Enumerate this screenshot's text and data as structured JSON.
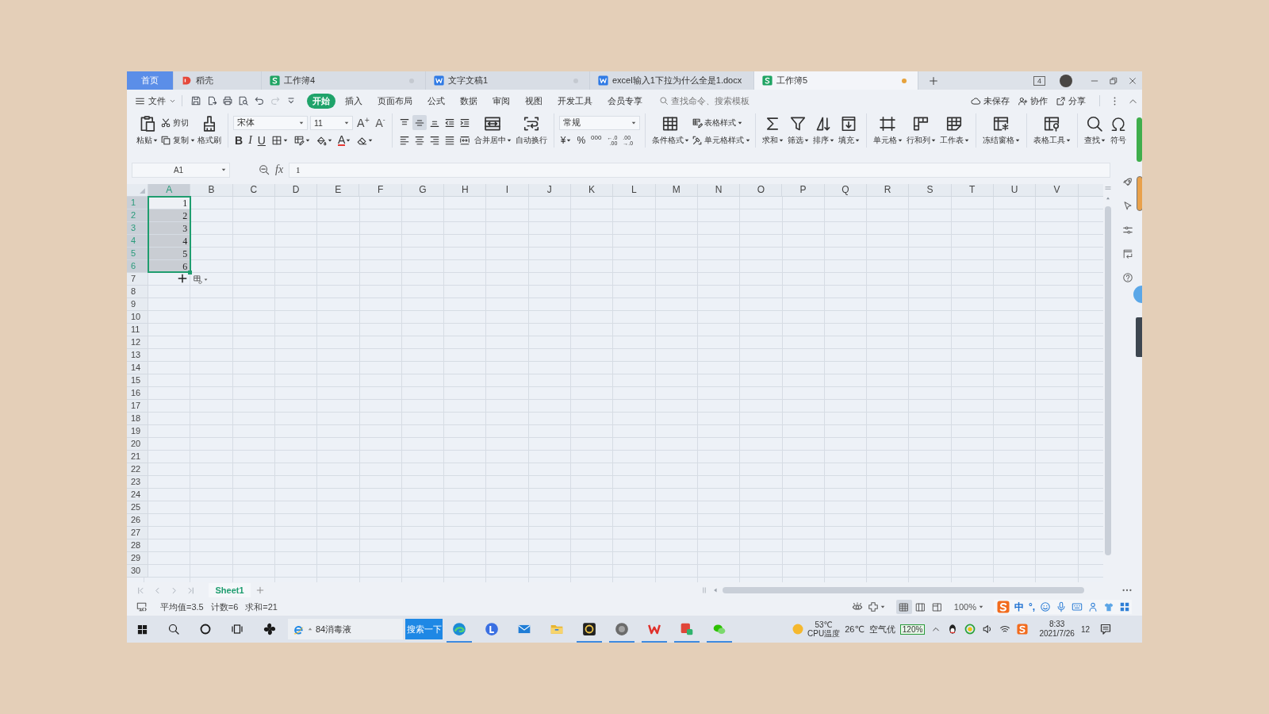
{
  "tabs": [
    {
      "label": "首页",
      "kind": "home",
      "selected": false
    },
    {
      "label": "稻壳",
      "kind": "docer",
      "selected": false
    },
    {
      "label": "工作簿4",
      "kind": "sheet",
      "selected": false,
      "color": "#c4c9d0"
    },
    {
      "label": "文字文稿1",
      "kind": "writer",
      "selected": false,
      "color": "#c4c9d0"
    },
    {
      "label": "excel输入1下拉为什么全是1.docx",
      "kind": "writer",
      "selected": false
    },
    {
      "label": "工作簿5",
      "kind": "sheet",
      "selected": true,
      "color": "#e6a23c"
    }
  ],
  "window_badge": "4",
  "menu": {
    "file": "文件",
    "quick_access": [
      {
        "kind": "save",
        "disabled": false
      },
      {
        "kind": "export",
        "disabled": false
      },
      {
        "kind": "print",
        "disabled": false
      },
      {
        "kind": "print-preview",
        "disabled": false
      },
      {
        "kind": "undo",
        "disabled": false
      },
      {
        "kind": "redo",
        "disabled": true
      },
      {
        "kind": "customize",
        "disabled": false
      }
    ],
    "tabs": [
      {
        "label": "开始",
        "selected": true
      },
      {
        "label": "插入",
        "selected": false
      },
      {
        "label": "页面布局",
        "selected": false
      },
      {
        "label": "公式",
        "selected": false
      },
      {
        "label": "数据",
        "selected": false
      },
      {
        "label": "审阅",
        "selected": false
      },
      {
        "label": "视图",
        "selected": false
      },
      {
        "label": "开发工具",
        "selected": false
      },
      {
        "label": "会员专享",
        "selected": false
      }
    ],
    "search": {
      "placeholder": "查找命令、搜索模板"
    },
    "actions": [
      {
        "kind": "save-status",
        "label": "未保存"
      },
      {
        "kind": "collaborate",
        "label": "协作"
      },
      {
        "kind": "share",
        "label": "分享"
      }
    ]
  },
  "ribbon": [
    {
      "kind": "buttons",
      "columns": [
        [
          {
            "kind": "paste",
            "label": "粘贴",
            "dropdown": true
          }
        ],
        [
          {
            "kind": "cut",
            "label": "剪切",
            "dropdown": false
          },
          {
            "kind": "copy",
            "label": "复制",
            "dropdown": true
          }
        ],
        [
          {
            "kind": "format-painter",
            "label": "格式刷",
            "dropdown": false
          }
        ]
      ]
    },
    {
      "kind": "font",
      "name": "宋体",
      "size": "11",
      "resize": [
        {
          "kind": "grow-font",
          "text": "A$^{+}$"
        },
        {
          "kind": "shrink-font",
          "text": "A$^{-}$"
        }
      ],
      "tools": [
        {
          "kind": "bold",
          "text": "B",
          "dropdown": false
        },
        {
          "kind": "italic",
          "text": "I",
          "dropdown": false
        },
        {
          "kind": "underline",
          "text": "U",
          "dropdown": false
        },
        {
          "kind": "border",
          "dropdown": true
        },
        {
          "kind": "fill-style",
          "dropdown": true
        },
        {
          "kind": "fill-color",
          "dropdown": true
        },
        {
          "kind": "font-color",
          "text": "A",
          "dropdown": true
        },
        {
          "kind": "clear",
          "dropdown": true
        }
      ]
    },
    {
      "kind": "alignment",
      "rows": [
        [
          {
            "kind": "align-top",
            "selected": false
          },
          {
            "kind": "align-middle",
            "selected": true
          },
          {
            "kind": "align-bottom",
            "selected": false
          },
          {
            "kind": "indent-decrease",
            "selected": false
          },
          {
            "kind": "indent-increase",
            "selected": false
          }
        ],
        [
          {
            "kind": "align-left",
            "selected": false
          },
          {
            "kind": "align-center",
            "selected": false
          },
          {
            "kind": "align-right",
            "selected": false
          },
          {
            "kind": "justify",
            "selected": false
          },
          {
            "kind": "distribute",
            "selected": false
          }
        ]
      ],
      "columns": [
        [
          {
            "kind": "merge-center",
            "label": "合并居中",
            "dropdown": true
          }
        ],
        [
          {
            "kind": "wrap-text",
            "label": "自动换行",
            "dropdown": false
          }
        ]
      ]
    },
    {
      "kind": "number",
      "format": "常规",
      "tools": [
        {
          "kind": "currency",
          "text": "¥",
          "dropdown": true
        },
        {
          "kind": "percent",
          "text": "%",
          "dropdown": false
        },
        {
          "kind": "thousands",
          "text": "000",
          "dropdown": false
        },
        {
          "kind": "decimal-increase",
          "lines": [
            "←.0",
            ".00"
          ],
          "dropdown": false
        },
        {
          "kind": "decimal-decrease",
          "lines": [
            ".00",
            "→.0"
          ],
          "dropdown": false
        }
      ]
    },
    {
      "kind": "buttons",
      "columns": [
        [
          {
            "kind": "conditional-format",
            "label": "条件格式",
            "dropdown": true
          }
        ],
        [
          {
            "kind": "table-style",
            "label": "表格样式",
            "dropdown": true
          },
          {
            "kind": "cell-style",
            "label": "单元格样式",
            "dropdown": true
          }
        ]
      ]
    },
    {
      "kind": "buttons",
      "columns": [
        [
          {
            "kind": "sum",
            "label": "求和",
            "dropdown": true
          }
        ],
        [
          {
            "kind": "filter",
            "label": "筛选",
            "dropdown": true
          }
        ],
        [
          {
            "kind": "sort",
            "label": "排序",
            "dropdown": true
          }
        ],
        [
          {
            "kind": "fill",
            "label": "填充",
            "dropdown": true
          }
        ]
      ]
    },
    {
      "kind": "buttons",
      "columns": [
        [
          {
            "kind": "cells",
            "label": "单元格",
            "dropdown": true
          }
        ],
        [
          {
            "kind": "rows-columns",
            "label": "行和列",
            "dropdown": true
          }
        ],
        [
          {
            "kind": "worksheet",
            "label": "工作表",
            "dropdown": true
          }
        ]
      ]
    },
    {
      "kind": "buttons",
      "columns": [
        [
          {
            "kind": "freeze-panes",
            "label": "冻结窗格",
            "dropdown": true
          }
        ]
      ]
    },
    {
      "kind": "buttons",
      "columns": [
        [
          {
            "kind": "table-tools",
            "label": "表格工具",
            "dropdown": true
          }
        ]
      ]
    },
    {
      "kind": "buttons",
      "columns": [
        [
          {
            "kind": "find",
            "label": "查找",
            "dropdown": true
          }
        ],
        [
          {
            "kind": "symbol",
            "label": "符号",
            "dropdown": false
          }
        ]
      ]
    }
  ],
  "formula_bar": {
    "name_box": "A1",
    "function_label": "fx",
    "value": "1"
  },
  "sheet": {
    "columns": [
      {
        "label": "A",
        "selected": true
      },
      {
        "label": "B",
        "selected": false
      },
      {
        "label": "C",
        "selected": false
      },
      {
        "label": "D",
        "selected": false
      },
      {
        "label": "E",
        "selected": false
      },
      {
        "label": "F",
        "selected": false
      },
      {
        "label": "G",
        "selected": false
      },
      {
        "label": "H",
        "selected": false
      },
      {
        "label": "I",
        "selected": false
      },
      {
        "label": "J",
        "selected": false
      },
      {
        "label": "K",
        "selected": false
      },
      {
        "label": "L",
        "selected": false
      },
      {
        "label": "M",
        "selected": false
      },
      {
        "label": "N",
        "selected": false
      },
      {
        "label": "O",
        "selected": false
      },
      {
        "label": "P",
        "selected": false
      },
      {
        "label": "Q",
        "selected": false
      },
      {
        "label": "R",
        "selected": false
      },
      {
        "label": "S",
        "selected": false
      },
      {
        "label": "T",
        "selected": false
      },
      {
        "label": "U",
        "selected": false
      },
      {
        "label": "V",
        "selected": false
      }
    ],
    "rows": [
      {
        "number": "1",
        "selected": true,
        "cells": [
          {
            "value": "1",
            "selected": true,
            "active": true
          }
        ]
      },
      {
        "number": "2",
        "selected": true,
        "cells": [
          {
            "value": "2",
            "selected": true,
            "active": false
          }
        ]
      },
      {
        "number": "3",
        "selected": true,
        "cells": [
          {
            "value": "3",
            "selected": true,
            "active": false
          }
        ]
      },
      {
        "number": "4",
        "selected": true,
        "cells": [
          {
            "value": "4",
            "selected": true,
            "active": false
          }
        ]
      },
      {
        "number": "5",
        "selected": true,
        "cells": [
          {
            "value": "5",
            "selected": true,
            "active": false
          }
        ]
      },
      {
        "number": "6",
        "selected": true,
        "cells": [
          {
            "value": "6",
            "selected": true,
            "active": false
          }
        ]
      },
      {
        "number": "7",
        "selected": false
      },
      {
        "number": "8",
        "selected": false
      },
      {
        "number": "9",
        "selected": false
      },
      {
        "number": "10",
        "selected": false
      },
      {
        "number": "11",
        "selected": false
      },
      {
        "number": "12",
        "selected": false
      },
      {
        "number": "13",
        "selected": false
      },
      {
        "number": "14",
        "selected": false
      },
      {
        "number": "15",
        "selected": false
      },
      {
        "number": "16",
        "selected": false
      },
      {
        "number": "17",
        "selected": false
      },
      {
        "number": "18",
        "selected": false
      },
      {
        "number": "19",
        "selected": false
      },
      {
        "number": "20",
        "selected": false
      },
      {
        "number": "21",
        "selected": false
      },
      {
        "number": "22",
        "selected": false
      },
      {
        "number": "23",
        "selected": false
      },
      {
        "number": "24",
        "selected": false
      },
      {
        "number": "25",
        "selected": false
      },
      {
        "number": "26",
        "selected": false
      },
      {
        "number": "27",
        "selected": false
      },
      {
        "number": "28",
        "selected": false
      },
      {
        "number": "29",
        "selected": false
      },
      {
        "number": "30",
        "selected": false
      }
    ]
  },
  "sheet_tabs": [
    {
      "label": "Sheet1",
      "selected": true
    }
  ],
  "status_bar": {
    "summary": [
      "平均值=3.5",
      "计数=6",
      "求和=21"
    ],
    "views": [
      {
        "kind": "normal",
        "selected": true
      },
      {
        "kind": "page-layout",
        "selected": false
      },
      {
        "kind": "reading",
        "selected": false
      }
    ],
    "zoom": "100%"
  },
  "ime": {
    "mode": "中",
    "punctuation": "°,"
  },
  "taskbar": {
    "search": {
      "value": "84消毒液"
    },
    "search_button": "搜索一下",
    "apps": [
      {
        "kind": "browser",
        "running": true
      },
      {
        "kind": "l-app",
        "running": false
      },
      {
        "kind": "mail",
        "running": false
      },
      {
        "kind": "files",
        "running": false
      },
      {
        "kind": "g-app",
        "running": true
      },
      {
        "kind": "disc-app",
        "running": true
      },
      {
        "kind": "office",
        "running": true
      },
      {
        "kind": "office-form",
        "running": true
      },
      {
        "kind": "chat",
        "running": true
      }
    ],
    "tray": {
      "cpu_temp": "53℃",
      "cpu_label": "CPU温度",
      "weather_temp": "26℃",
      "air_quality": "空气优",
      "meter": "120%",
      "time": "8:33",
      "date": "2021/7/26",
      "notifications": "12"
    }
  }
}
